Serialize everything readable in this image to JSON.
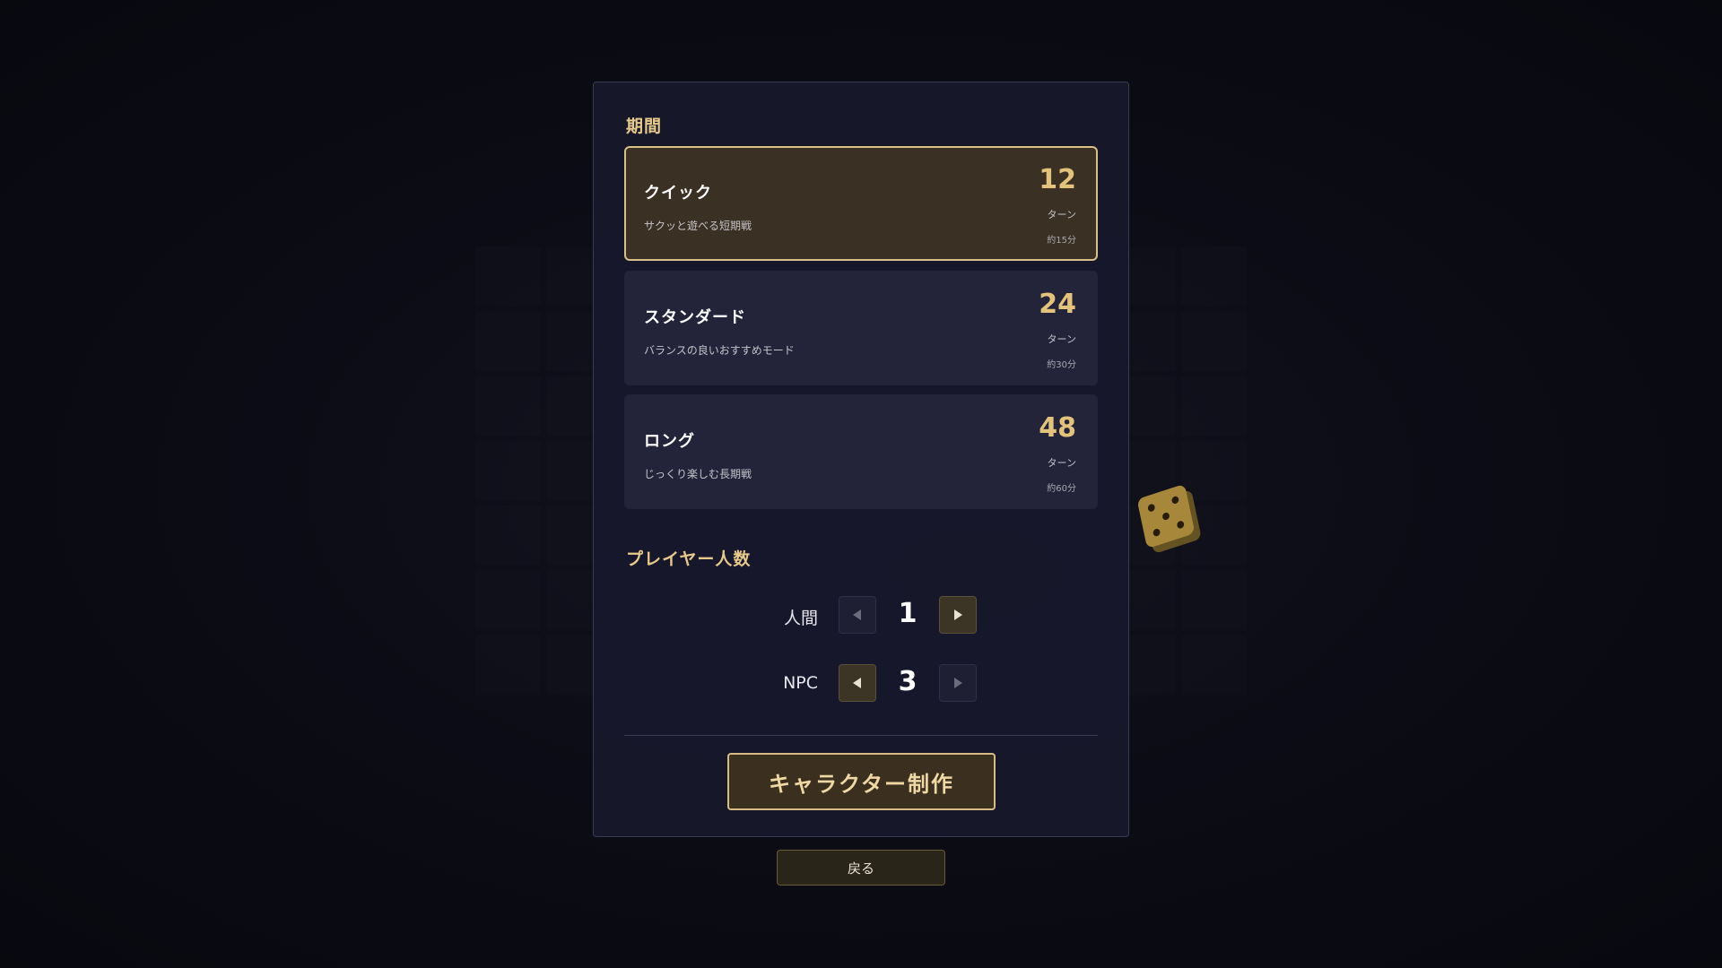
{
  "duration": {
    "title": "期間",
    "options": [
      {
        "name": "クイック",
        "desc": "サクッと遊べる短期戦",
        "turns": "12",
        "unit": "ターン",
        "time": "約15分",
        "selected": true
      },
      {
        "name": "スタンダード",
        "desc": "バランスの良いおすすめモード",
        "turns": "24",
        "unit": "ターン",
        "time": "約30分",
        "selected": false
      },
      {
        "name": "ロング",
        "desc": "じっくり楽しむ長期戦",
        "turns": "48",
        "unit": "ターン",
        "time": "約60分",
        "selected": false
      }
    ]
  },
  "players": {
    "title": "プレイヤー人数",
    "human": {
      "label": "人間",
      "value": "1",
      "decrement_enabled": false,
      "increment_enabled": true
    },
    "npc": {
      "label": "NPC",
      "value": "3",
      "decrement_enabled": true,
      "increment_enabled": false
    }
  },
  "actions": {
    "create_label": "キャラクター制作",
    "back_label": "戻る"
  },
  "icons": {
    "decrement": "triangle-left-icon",
    "increment": "triangle-right-icon"
  },
  "colors": {
    "accent": "#e3c37c",
    "selected_border": "#dcc08a",
    "panel_bg": "#17182b"
  }
}
